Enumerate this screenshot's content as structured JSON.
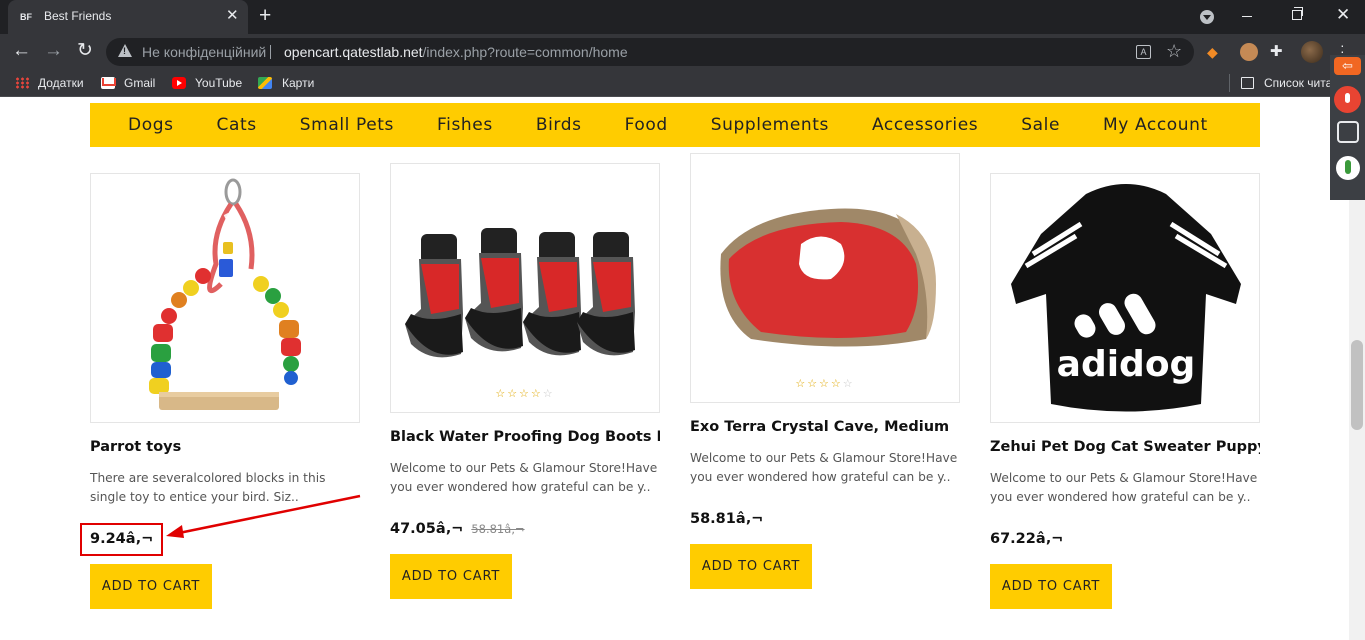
{
  "browser": {
    "tab_favicon": "BF",
    "tab_title": "Best Friends",
    "tab_close": "✕",
    "new_tab": "+",
    "not_secure": "Не конфіденційний",
    "url_host": "opencart.qatestlab.net",
    "url_path": "/index.php?route=common/home",
    "bookmarks": {
      "apps": "Додатки",
      "gmail": "Gmail",
      "youtube": "YouTube",
      "maps": "Карти",
      "reading_list": "Список чита"
    }
  },
  "nav": {
    "items": [
      "Dogs",
      "Cats",
      "Small Pets",
      "Fishes",
      "Birds",
      "Food",
      "Supplements",
      "Accessories",
      "Sale",
      "My Account"
    ]
  },
  "products": [
    {
      "name": "Parrot toys",
      "description": "There are severalcolored blocks in this single toy to entice your bird. Siz..",
      "price": "9.24â‚¬",
      "price_old": "",
      "rating_stars": 0,
      "button": "ADD TO CART",
      "image_icon": "parrot-swing-toy"
    },
    {
      "name": "Black Water Proofing Dog Boots Pe...",
      "description": "Welcome to our Pets & Glamour Store!Have you ever wondered how grateful can be y..",
      "price": "47.05â‚¬",
      "price_old": "58.81â‚¬",
      "rating_stars": 0,
      "button": "ADD TO CART",
      "image_icon": "dog-boots"
    },
    {
      "name": "Exo Terra Crystal Cave, Medium",
      "description": "Welcome to our Pets & Glamour Store!Have you ever wondered how grateful can be y..",
      "price": "58.81â‚¬",
      "price_old": "",
      "rating_stars": 0,
      "button": "ADD TO CART",
      "image_icon": "crystal-cave"
    },
    {
      "name": "Zehui Pet Dog Cat Sweater Puppy T...",
      "description": "Welcome to our Pets & Glamour Store!Have you ever wondered how grateful can be y..",
      "price": "67.22â‚¬",
      "price_old": "",
      "rating_stars": 0,
      "button": "ADD TO CART",
      "image_icon": "dog-sweater",
      "image_text": "adidog"
    }
  ],
  "annotation": {
    "color": "#e00000",
    "target": "Parrot toys price"
  },
  "colors": {
    "accent": "#ffcc00",
    "chrome_dark": "#202124",
    "chrome_toolbar": "#35363a"
  }
}
